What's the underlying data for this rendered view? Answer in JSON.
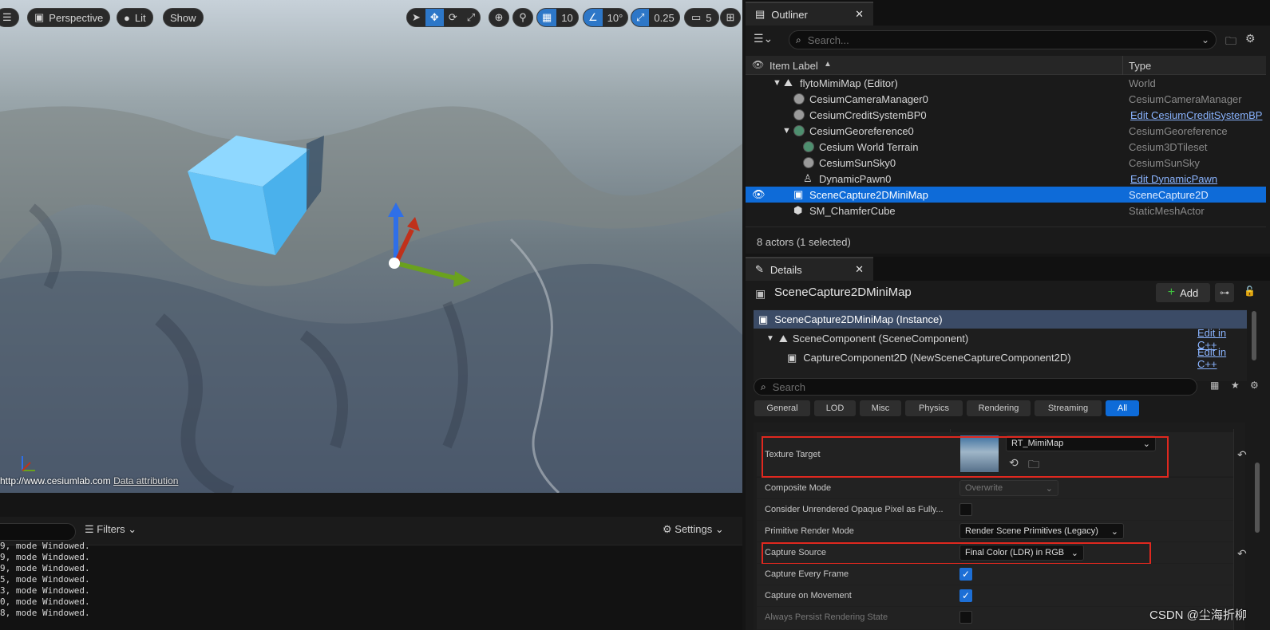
{
  "viewport": {
    "menu_icon": "hamburger-icon",
    "perspective_label": "Perspective",
    "lit_label": "Lit",
    "show_label": "Show",
    "grid_snap": "10",
    "rotation_snap": "10°",
    "scale_snap": "0.25",
    "camera_speed": "5",
    "attribution_url": "http://www.cesiumlab.com",
    "attribution_link": "Data attribution"
  },
  "log": {
    "filters_label": "Filters",
    "settings_label": "Settings",
    "lines": [
      "9, mode Windowed.",
      "9, mode Windowed.",
      "9, mode Windowed.",
      "5, mode Windowed.",
      "3, mode Windowed.",
      "0, mode Windowed.",
      "8, mode Windowed."
    ]
  },
  "outliner": {
    "tab_label": "Outliner",
    "search_placeholder": "Search...",
    "col_item_label": "Item Label",
    "col_type": "Type",
    "rows": [
      {
        "label": "flytoMimiMap (Editor)",
        "type": "World"
      },
      {
        "label": "CesiumCameraManager0",
        "type": "CesiumCameraManager"
      },
      {
        "label": "CesiumCreditSystemBP0",
        "type": "Edit CesiumCreditSystemBP"
      },
      {
        "label": "CesiumGeoreference0",
        "type": "CesiumGeoreference"
      },
      {
        "label": "Cesium World Terrain",
        "type": "Cesium3DTileset"
      },
      {
        "label": "CesiumSunSky0",
        "type": "CesiumSunSky"
      },
      {
        "label": "DynamicPawn0",
        "type": "Edit DynamicPawn"
      },
      {
        "label": "SceneCapture2DMiniMap",
        "type": "SceneCapture2D"
      },
      {
        "label": "SM_ChamferCube",
        "type": "StaticMeshActor"
      }
    ],
    "status": "8 actors (1 selected)"
  },
  "details": {
    "tab_label": "Details",
    "actor_name": "SceneCapture2DMiniMap",
    "add_label": "Add",
    "components": [
      {
        "label": "SceneCapture2DMiniMap (Instance)",
        "action": ""
      },
      {
        "label": "SceneComponent (SceneComponent)",
        "action": "Edit in C++"
      },
      {
        "label": "CaptureComponent2D (NewSceneCaptureComponent2D)",
        "action": "Edit in C++"
      }
    ],
    "search_placeholder": "Search",
    "filters": [
      "General",
      "LOD",
      "Misc",
      "Physics",
      "Rendering",
      "Streaming",
      "All"
    ],
    "props": {
      "texture_target": {
        "name": "Texture Target",
        "value": "RT_MimiMap"
      },
      "composite_mode": {
        "name": "Composite Mode",
        "value": "Overwrite"
      },
      "consider_unrendered": {
        "name": "Consider Unrendered Opaque Pixel as Fully..."
      },
      "primitive_render_mode": {
        "name": "Primitive Render Mode",
        "value": "Render Scene Primitives (Legacy)"
      },
      "capture_source": {
        "name": "Capture Source",
        "value": "Final Color (LDR) in RGB"
      },
      "capture_every_frame": {
        "name": "Capture Every Frame"
      },
      "capture_on_movement": {
        "name": "Capture on Movement"
      },
      "always_persist": {
        "name": "Always Persist Rendering State"
      }
    }
  },
  "watermark": "CSDN @尘海折柳"
}
